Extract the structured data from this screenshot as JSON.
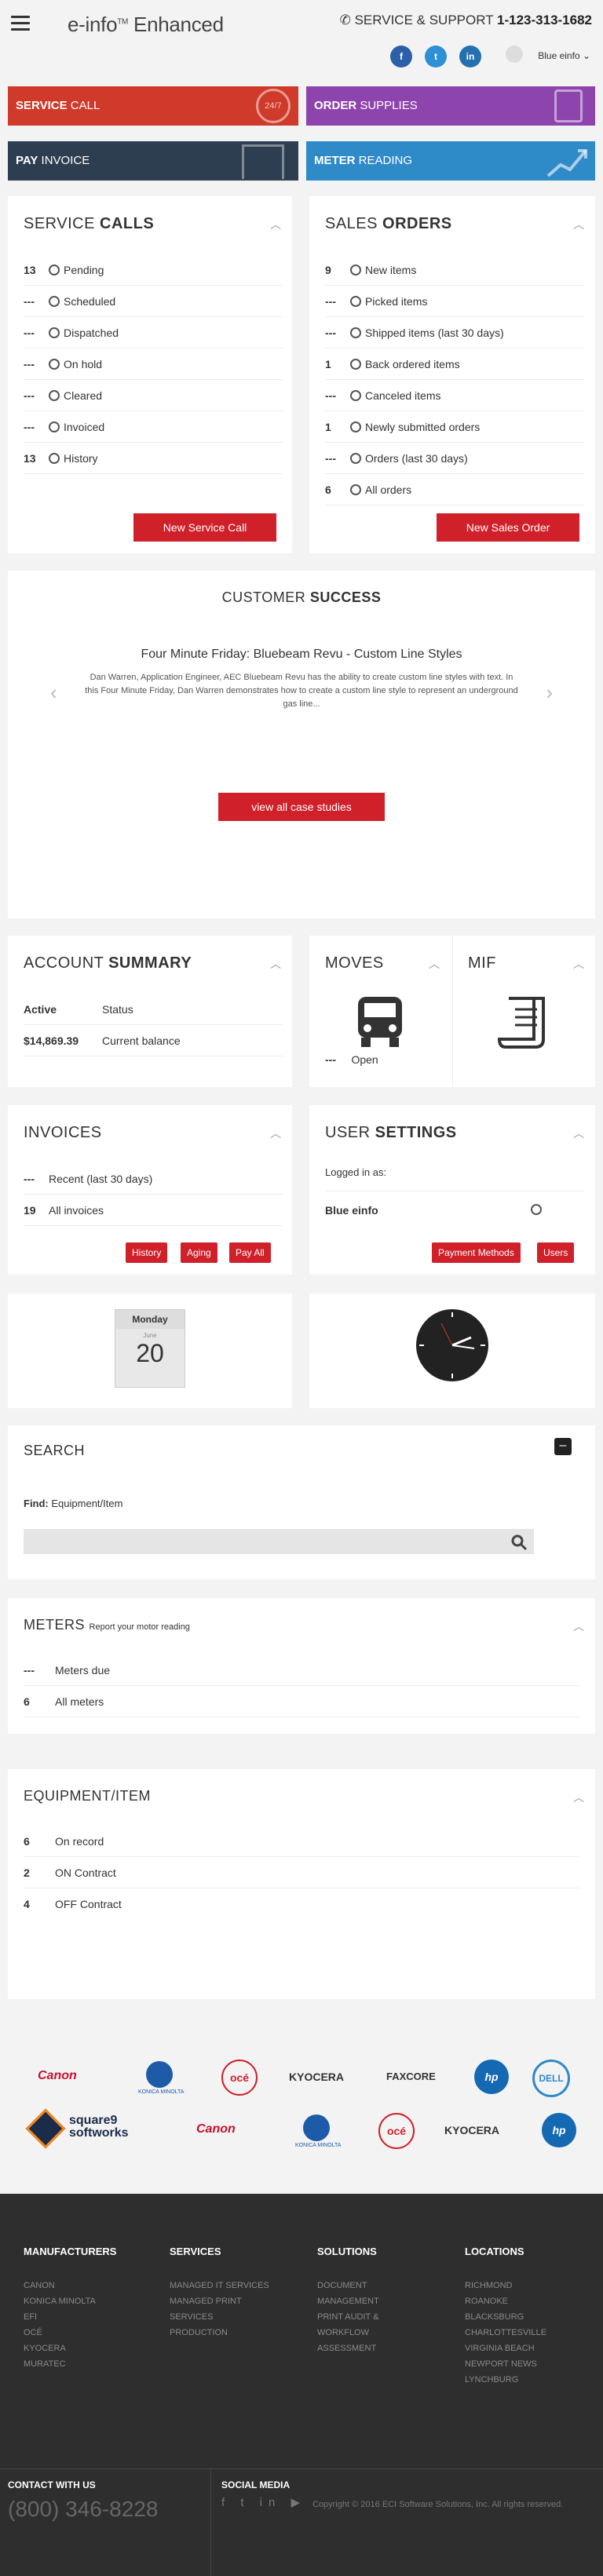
{
  "header": {
    "logo": "e-info",
    "logo_tm": "TM",
    "logo_suffix": "Enhanced",
    "support_label": "SERVICE & SUPPORT",
    "support_phone": "1-123-313-1682",
    "social": [
      "f",
      "t",
      "in"
    ],
    "user": "Blue einfo"
  },
  "tiles": [
    {
      "bold": "SERVICE",
      "rest": " CALL",
      "color": "#cf3a2a",
      "icon": "24/7"
    },
    {
      "bold": "ORDER",
      "rest": " SUPPLIES",
      "color": "#8e44ad",
      "icon": ""
    },
    {
      "bold": "PAY",
      "rest": " INVOICE",
      "color": "#2c3e50",
      "icon": ""
    },
    {
      "bold": "METER",
      "rest": " READING",
      "color": "#2f8ac8",
      "icon": ""
    }
  ],
  "service_calls": {
    "title_light": "SERVICE",
    "title_bold": "CALLS",
    "rows": [
      {
        "n": "13",
        "label": "Pending"
      },
      {
        "n": "---",
        "label": "Scheduled"
      },
      {
        "n": "---",
        "label": "Dispatched"
      },
      {
        "n": "---",
        "label": "On hold"
      },
      {
        "n": "---",
        "label": "Cleared"
      },
      {
        "n": "---",
        "label": "Invoiced"
      },
      {
        "n": "13",
        "label": "History"
      }
    ],
    "button": "New Service Call"
  },
  "sales_orders": {
    "title_light": "SALES",
    "title_bold": "ORDERS",
    "rows": [
      {
        "n": "9",
        "label": "New items"
      },
      {
        "n": "---",
        "label": "Picked items"
      },
      {
        "n": "---",
        "label": "Shipped items (last 30 days)"
      },
      {
        "n": "1",
        "label": "Back ordered items"
      },
      {
        "n": "---",
        "label": "Canceled items"
      },
      {
        "n": "1",
        "label": "Newly submitted orders"
      },
      {
        "n": "---",
        "label": "Orders (last 30 days)"
      },
      {
        "n": "6",
        "label": "All orders"
      }
    ],
    "button": "New Sales Order"
  },
  "customer_success": {
    "title_light": "CUSTOMER",
    "title_bold": "SUCCESS",
    "headline": "Four Minute Friday: Bluebeam Revu - Custom Line Styles",
    "body": "Dan Warren, Application Engineer, AEC Bluebeam Revu has the ability to create custom line styles with text. In this Four Minute Friday, Dan Warren demonstrates how to create a custom line style to represent an underground gas line...",
    "button": "view all case studies"
  },
  "account_summary": {
    "title_light": "ACCOUNT",
    "title_bold": "SUMMARY",
    "rows": [
      {
        "n": "Active",
        "label": "Status"
      },
      {
        "n": "$14,869.39",
        "label": "Current balance"
      }
    ]
  },
  "moves": {
    "title": "MOVES",
    "value": "---",
    "label": "Open"
  },
  "mif": {
    "title": "MIF"
  },
  "invoices": {
    "title": "INVOICES",
    "rows": [
      {
        "n": "---",
        "label": "Recent (last 30 days)"
      },
      {
        "n": "19",
        "label": "All invoices"
      }
    ],
    "buttons": [
      "History",
      "Aging",
      "Pay All"
    ]
  },
  "user_settings": {
    "title_light": "USER",
    "title_bold": "SETTINGS",
    "logged_label": "Logged in as:",
    "user": "Blue einfo",
    "buttons": [
      "Payment Methods",
      "Users"
    ]
  },
  "calendar": {
    "day": "Monday",
    "month": "June",
    "date": "20"
  },
  "search": {
    "title": "SEARCH",
    "find_label": "Find:",
    "find_value": "Equipment/Item",
    "placeholder": ""
  },
  "meters": {
    "title": "METERS",
    "subtitle": "Report your motor reading",
    "rows": [
      {
        "n": "---",
        "label": "Meters due"
      },
      {
        "n": "6",
        "label": "All meters"
      }
    ]
  },
  "equipment": {
    "title": "EQUIPMENT/ITEM",
    "rows": [
      {
        "n": "6",
        "label": "On record"
      },
      {
        "n": "2",
        "label": "ON Contract"
      },
      {
        "n": "4",
        "label": "OFF Contract"
      }
    ]
  },
  "partners_row1": [
    "Canon",
    "KONICA MINOLTA",
    "océ",
    "KYOCERA",
    "FAXCORE",
    "hp",
    "DELL"
  ],
  "partners_row2": [
    "square9 softworks",
    "Canon",
    "KONICA MINOLTA",
    "océ",
    "KYOCERA",
    "hp"
  ],
  "footer": {
    "cols": [
      {
        "title": "MANUFACTURERS",
        "items": [
          "CANON",
          "KONICA MINOLTA",
          "EFI",
          "OCÉ",
          "KYOCERA",
          "MURATEC"
        ]
      },
      {
        "title": "SERVICES",
        "items": [
          "MANAGED IT SERVICES",
          "MANAGED PRINT",
          "SERVICES",
          "PRODUCTION"
        ]
      },
      {
        "title": "SOLUTIONS",
        "items": [
          "DOCUMENT",
          "MANAGEMENT",
          "PRINT AUDIT &",
          "WORKFLOW",
          "ASSESSMENT"
        ]
      },
      {
        "title": "LOCATIONS",
        "items": [
          "RICHMOND",
          "ROANOKE",
          "BLACKSBURG",
          "CHARLOTTESVILLE",
          "VIRGINIA BEACH",
          "NEWPORT NEWS",
          "LYNCHBURG"
        ]
      }
    ],
    "contact_label": "CONTACT WITH US",
    "phone": "(800) 346-8228",
    "social_label": "SOCIAL MEDIA",
    "copyright": "Copyright © 2016 ECI Software Solutions, Inc. All rights reserved."
  }
}
